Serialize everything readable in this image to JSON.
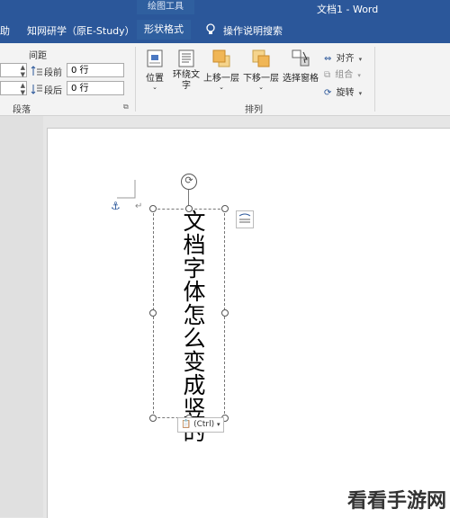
{
  "window": {
    "context_label": "绘图工具",
    "title": "文档1 - Word"
  },
  "tabs": [
    {
      "label": "助"
    },
    {
      "label": "知网研学（原E-Study）"
    },
    {
      "label": "形状格式"
    },
    {
      "label": "操作说明搜索"
    }
  ],
  "paragraph_group": {
    "spacing_label": "间距",
    "before_label": "段前",
    "after_label": "段后",
    "before_value": "0 行",
    "after_value": "0 行",
    "group_name": "段落"
  },
  "arrange_group": {
    "position_label": "位置",
    "wrap_label": "环绕文\n字",
    "bring_forward_label": "上移一层",
    "send_backward_label": "下移一层",
    "selection_pane_label": "选择窗格",
    "align_label": "对齐",
    "group_label": "组合",
    "rotate_label": "旋转",
    "group_name": "排列"
  },
  "document": {
    "vertical_text": "文档字体怎么变成竖的",
    "paste_options_label": "(Ctrl)"
  },
  "watermark": "看看手游网"
}
